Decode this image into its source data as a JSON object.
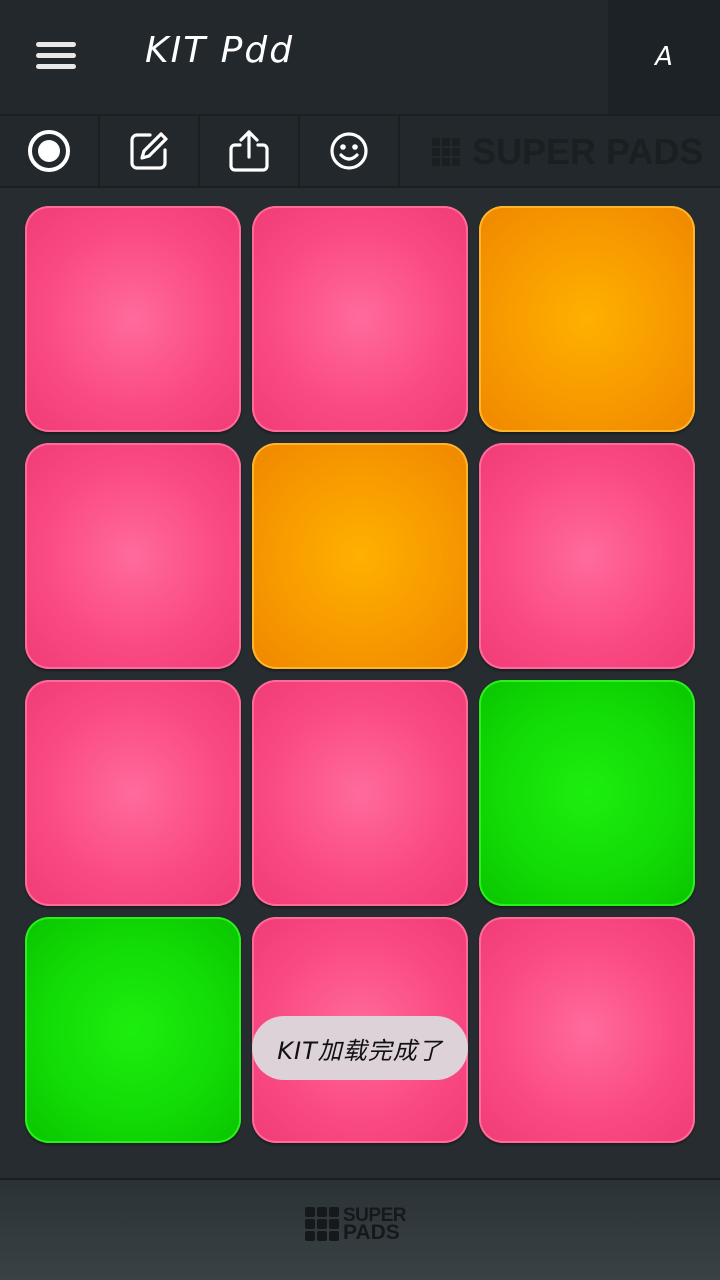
{
  "header": {
    "kit_title": "KIT Pdd",
    "kit_letter": "A"
  },
  "toolbar": {
    "items": [
      {
        "icon": "record-icon"
      },
      {
        "icon": "edit-icon"
      },
      {
        "icon": "share-icon"
      },
      {
        "icon": "smiley-icon"
      }
    ],
    "brand": "SUPER PADS"
  },
  "pads": [
    {
      "color": "pink"
    },
    {
      "color": "pink"
    },
    {
      "color": "orange"
    },
    {
      "color": "pink"
    },
    {
      "color": "orange"
    },
    {
      "color": "pink"
    },
    {
      "color": "pink"
    },
    {
      "color": "pink"
    },
    {
      "color": "green"
    },
    {
      "color": "green"
    },
    {
      "color": "pink"
    },
    {
      "color": "pink"
    }
  ],
  "colors": {
    "pink": "#fb4b84",
    "orange": "#f79a00",
    "green": "#12dc06",
    "background": "#262c30"
  },
  "toast": {
    "text": "KIT加载完成了"
  },
  "footer": {
    "logo_line1": "SUPER",
    "logo_line2": "PADS"
  }
}
